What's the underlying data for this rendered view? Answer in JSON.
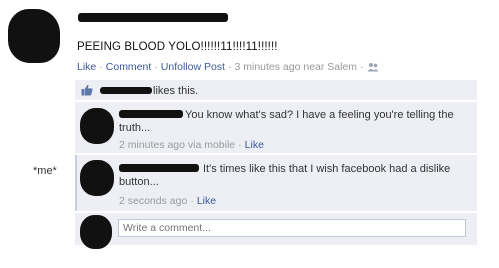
{
  "post": {
    "text": "PEEING BLOOD YOLO!!!!!!11!!!!11!!!!!!",
    "actions": {
      "like": "Like",
      "comment": "Comment",
      "unfollow": "Unfollow Post",
      "time": "3 minutes ago near Salem",
      "audience_icon": "friends-icon"
    }
  },
  "likes": {
    "icon": "thumbs-up-icon",
    "text": "likes this."
  },
  "comments": [
    {
      "text": "You know what's sad? I have a feeling you're telling the truth...",
      "time": "2 minutes ago via mobile",
      "like": "Like"
    },
    {
      "text": "It's times like this that I wish facebook had a dislike button...",
      "time": "2 seconds ago",
      "like": "Like"
    }
  ],
  "annotation": "*me*",
  "composer": {
    "placeholder": "Write a comment..."
  },
  "colors": {
    "link": "#3b5998",
    "comment_bg": "#edeff4",
    "meta": "#999999"
  }
}
